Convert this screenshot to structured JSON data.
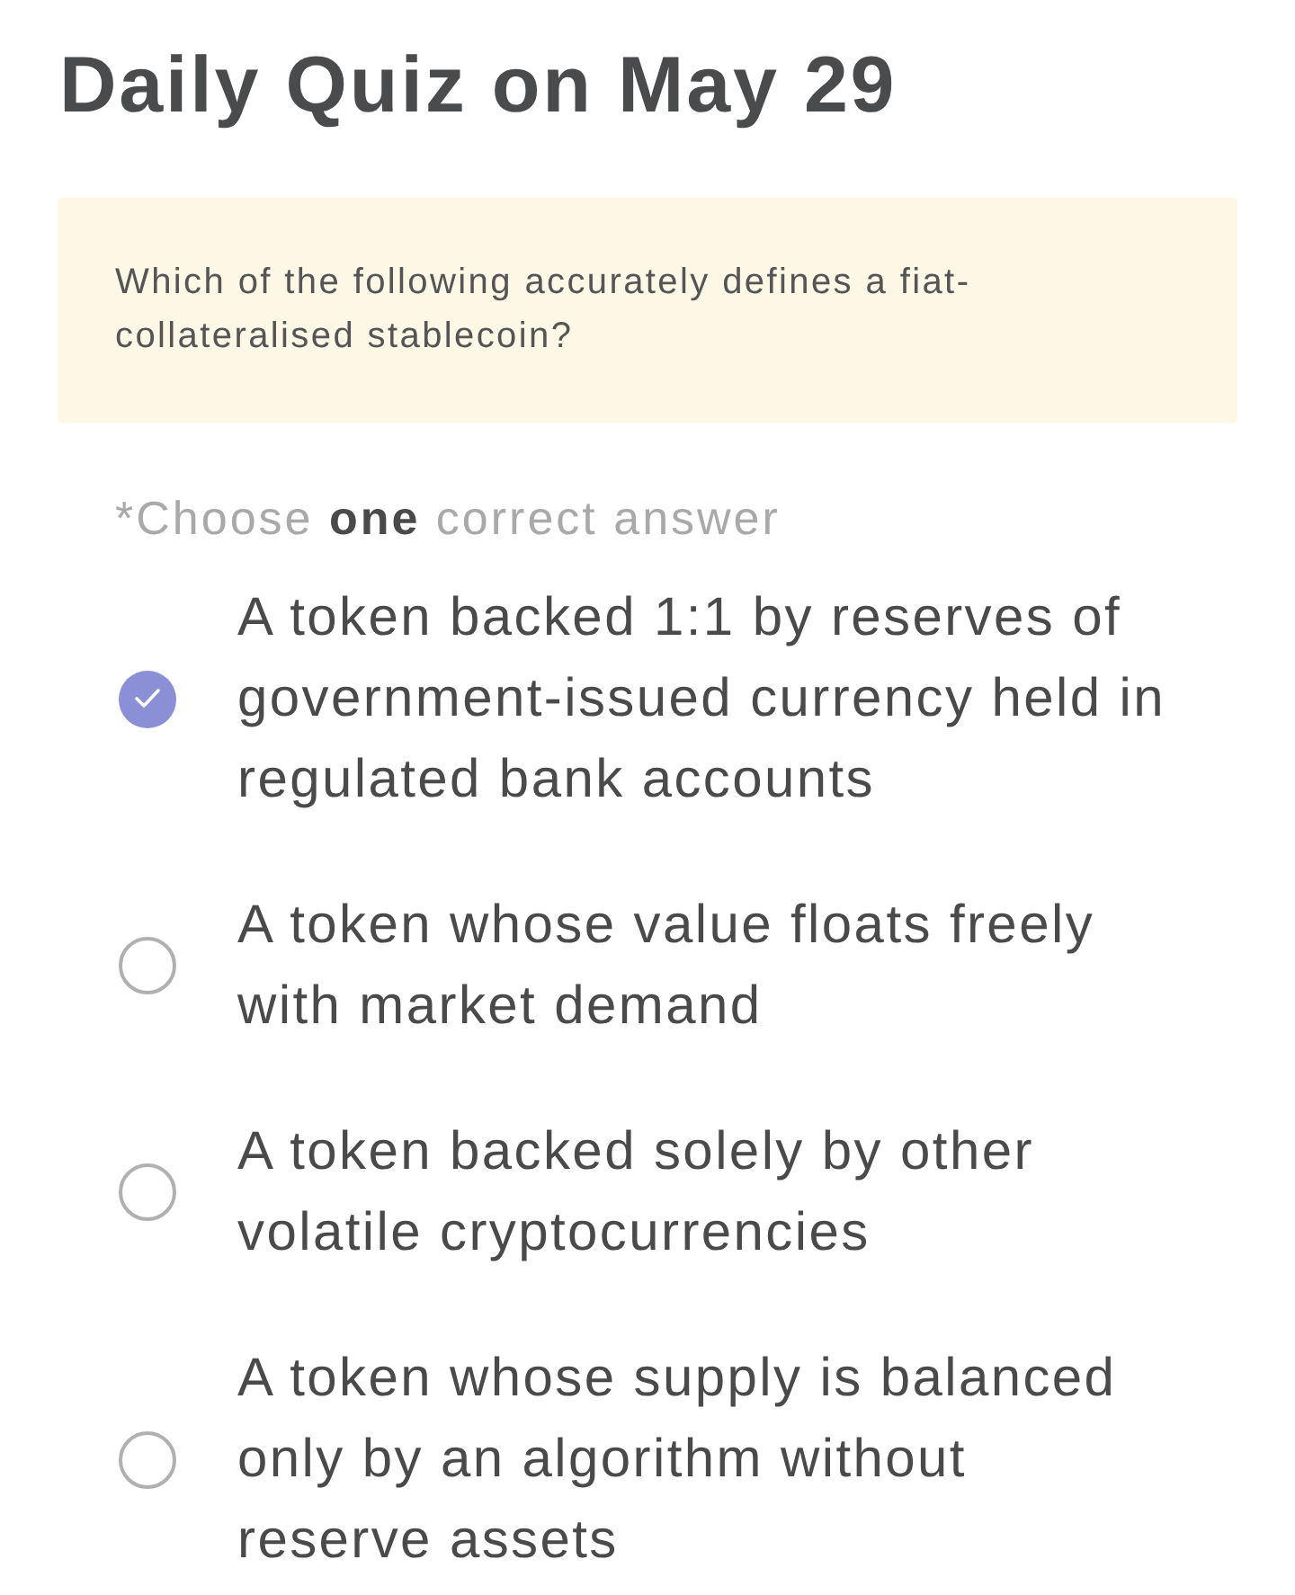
{
  "title": "Daily Quiz on May 29",
  "question": {
    "text": "Which of the following accurately defines a fiat-collateralised stablecoin?"
  },
  "hint": "*Choose **one** correct answer",
  "options": [
    {
      "text": "A token backed 1:1 by reserves of government-issued currency held in regulated bank accounts",
      "selected": true
    },
    {
      "text": "A token whose value floats freely with market demand",
      "selected": false
    },
    {
      "text": "A token backed solely by other volatile cryptocurrencies",
      "selected": false
    },
    {
      "text": "A token whose supply is balanced only by an algorithm without reserve assets",
      "selected": false
    }
  ]
}
